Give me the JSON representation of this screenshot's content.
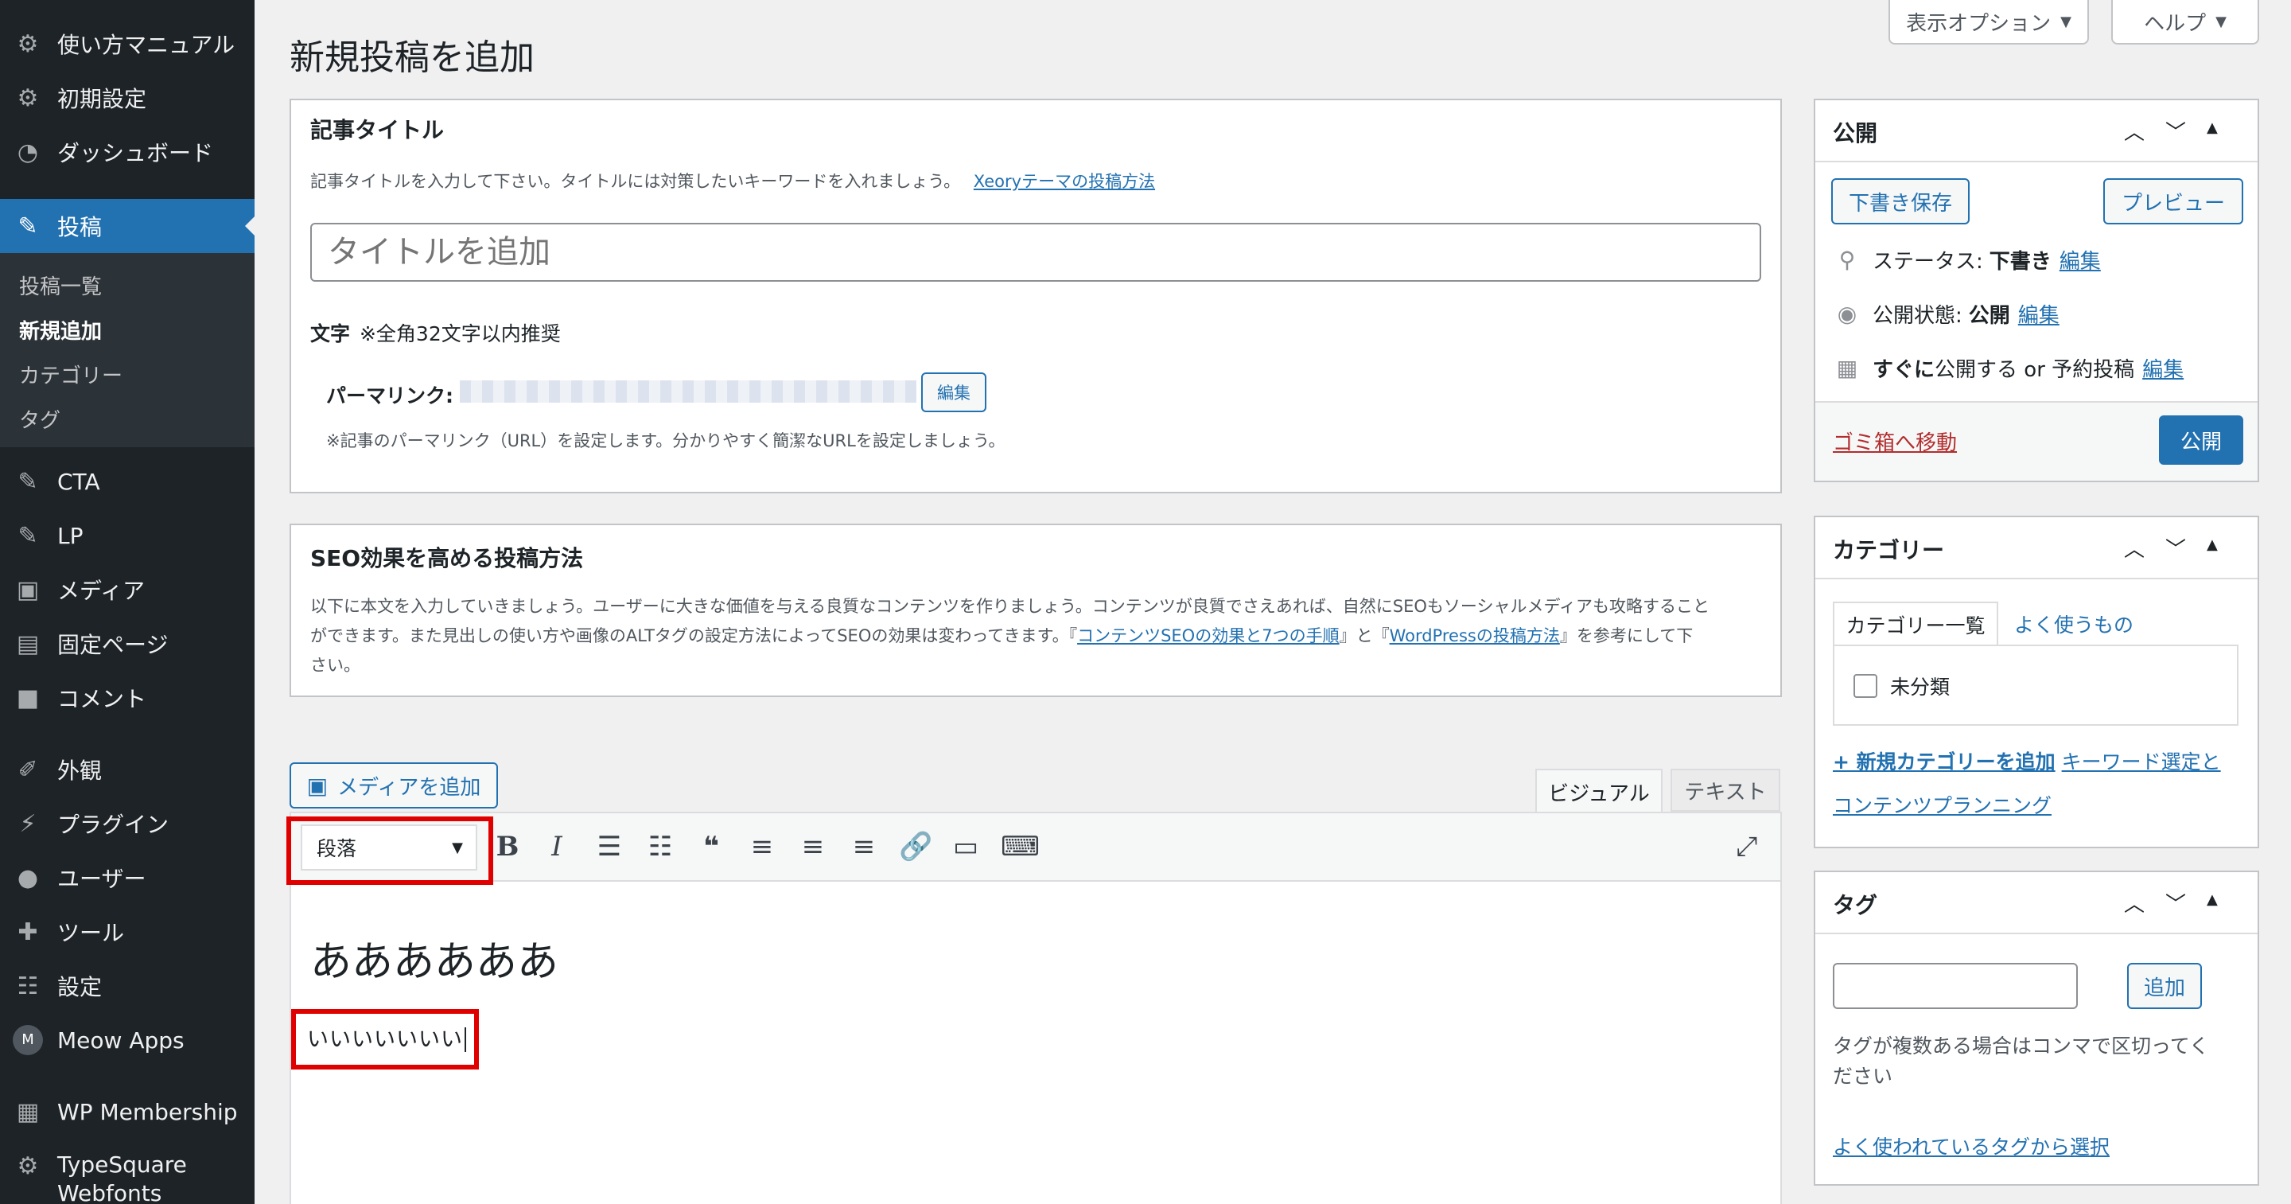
{
  "sidebar": {
    "items": [
      {
        "label": "使い方マニュアル",
        "icon": "gear-icon"
      },
      {
        "label": "初期設定",
        "icon": "gear-icon"
      },
      {
        "label": "ダッシュボード",
        "icon": "dashboard-icon"
      },
      {
        "label": "投稿",
        "icon": "pin-icon"
      },
      {
        "label": "CTA",
        "icon": "pin-icon"
      },
      {
        "label": "LP",
        "icon": "pin-icon"
      },
      {
        "label": "メディア",
        "icon": "media-icon"
      },
      {
        "label": "固定ページ",
        "icon": "page-icon"
      },
      {
        "label": "コメント",
        "icon": "comment-icon"
      },
      {
        "label": "外観",
        "icon": "brush-icon"
      },
      {
        "label": "プラグイン",
        "icon": "plugin-icon"
      },
      {
        "label": "ユーザー",
        "icon": "user-icon"
      },
      {
        "label": "ツール",
        "icon": "wrench-icon"
      },
      {
        "label": "設定",
        "icon": "settings-icon"
      },
      {
        "label": "Meow Apps",
        "icon": "meow-icon"
      },
      {
        "label": "WP Membership",
        "icon": "membership-icon"
      },
      {
        "label": "TypeSquare Webfonts",
        "icon": "gear-icon"
      }
    ],
    "submenu": [
      "投稿一覧",
      "新規追加",
      "カテゴリー",
      "タグ"
    ]
  },
  "header": {
    "title": "新規投稿を追加",
    "screen_options": "表示オプション",
    "help": "ヘルプ"
  },
  "title_box": {
    "heading": "記事タイトル",
    "description": "記事タイトルを入力して下さい。タイトルには対策したいキーワードを入れましょう。",
    "link": "Xeoryテーマの投稿方法",
    "placeholder": "タイトルを追加",
    "char_label": "文字",
    "char_note": "※全角32文字以内推奨",
    "permalink_label": "パーマリンク:",
    "edit_button": "編集",
    "permalink_note": "※記事のパーマリンク（URL）を設定します。分かりやすく簡潔なURLを設定しましょう。"
  },
  "seo_box": {
    "heading": "SEO効果を高める投稿方法",
    "line1": "以下に本文を入力していきましょう。ユーザーに大きな価値を与える良質なコンテンツを作りましょう。コンテンツが良質でさえあれば、自然にSEOもソーシャルメディアも攻略すること",
    "line2a": "ができます。また見出しの使い方や画像のALTタグの設定方法によってSEOの効果は変わってきます。『",
    "link1": "コンテンツSEOの効果と7つの手順",
    "line2b": "』と『",
    "link2": "WordPressの投稿方法",
    "line2c": "』を参考にして下",
    "line3": "さい。"
  },
  "editor": {
    "add_media": "メディアを追加",
    "tab_visual": "ビジュアル",
    "tab_text": "テキスト",
    "format_select": "段落",
    "heading_text": "ああああああ",
    "paragraph_text": "いいいいいいい"
  },
  "publish_box": {
    "title": "公開",
    "save_draft": "下書き保存",
    "preview": "プレビュー",
    "status_label": "ステータス:",
    "status_value": "下書き",
    "visibility_label": "公開状態:",
    "visibility_value": "公開",
    "schedule_bold": "すぐに",
    "schedule_rest": "公開する or 予約投稿",
    "edit": "編集",
    "trash": "ゴミ箱へ移動",
    "publish": "公開"
  },
  "category_box": {
    "title": "カテゴリー",
    "tab_all": "カテゴリー一覧",
    "tab_popular": "よく使うもの",
    "item": "未分類",
    "add_new": "+ 新規カテゴリーを追加",
    "link_line1": "キーワード選定と",
    "link_line2": "コンテンツプランニング"
  },
  "tag_box": {
    "title": "タグ",
    "add": "追加",
    "hint": "タグが複数ある場合はコンマで区切ってください",
    "hint_line1": "タグが複数ある場合はコンマで区切ってく",
    "hint_line2": "ださい",
    "popular": "よく使われているタグから選択"
  },
  "colors": {
    "sidebar_bg": "#1d2327",
    "accent": "#2271b1",
    "highlight": "#e00000",
    "trash": "#b32d2e"
  }
}
